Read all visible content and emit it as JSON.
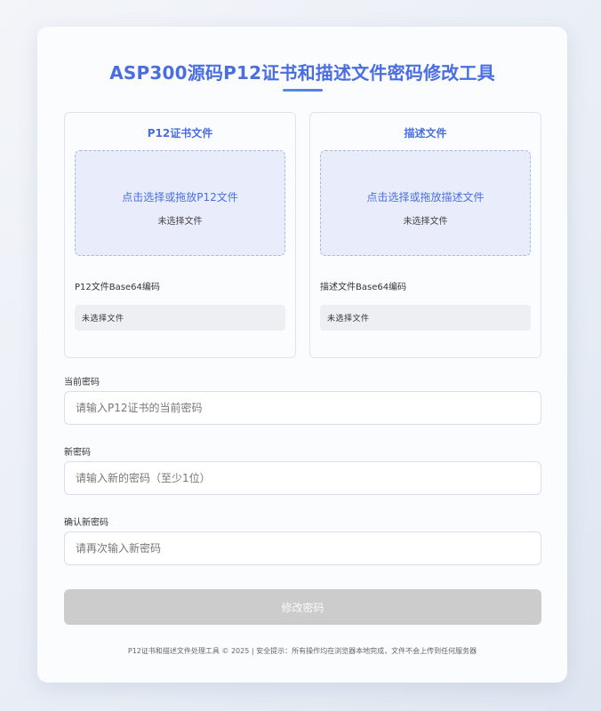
{
  "header": {
    "title": "ASP300源码P12证书和描述文件密码修改工具"
  },
  "panels": {
    "p12": {
      "title": "P12证书文件",
      "drop_text": "点击选择或拖放P12文件",
      "file_status": "未选择文件",
      "base64_label": "P12文件Base64编码",
      "base64_value": "未选择文件"
    },
    "profile": {
      "title": "描述文件",
      "drop_text": "点击选择或拖放描述文件",
      "file_status": "未选择文件",
      "base64_label": "描述文件Base64编码",
      "base64_value": "未选择文件"
    }
  },
  "form": {
    "current_password": {
      "label": "当前密码",
      "value": "",
      "placeholder": "请输入P12证书的当前密码"
    },
    "new_password": {
      "label": "新密码",
      "value": "",
      "placeholder": "请输入新的密码（至少1位）"
    },
    "confirm_password": {
      "label": "确认新密码",
      "value": "",
      "placeholder": "请再次输入新密码"
    },
    "submit_label": "修改密码"
  },
  "footer": {
    "text": "P12证书和描述文件处理工具 © 2025 | 安全提示：所有操作均在浏览器本地完成，文件不会上传到任何服务器"
  },
  "colors": {
    "accent": "#4a6ee0",
    "dropzone_bg": "#e9edfb",
    "button_disabled": "#cccccc"
  }
}
